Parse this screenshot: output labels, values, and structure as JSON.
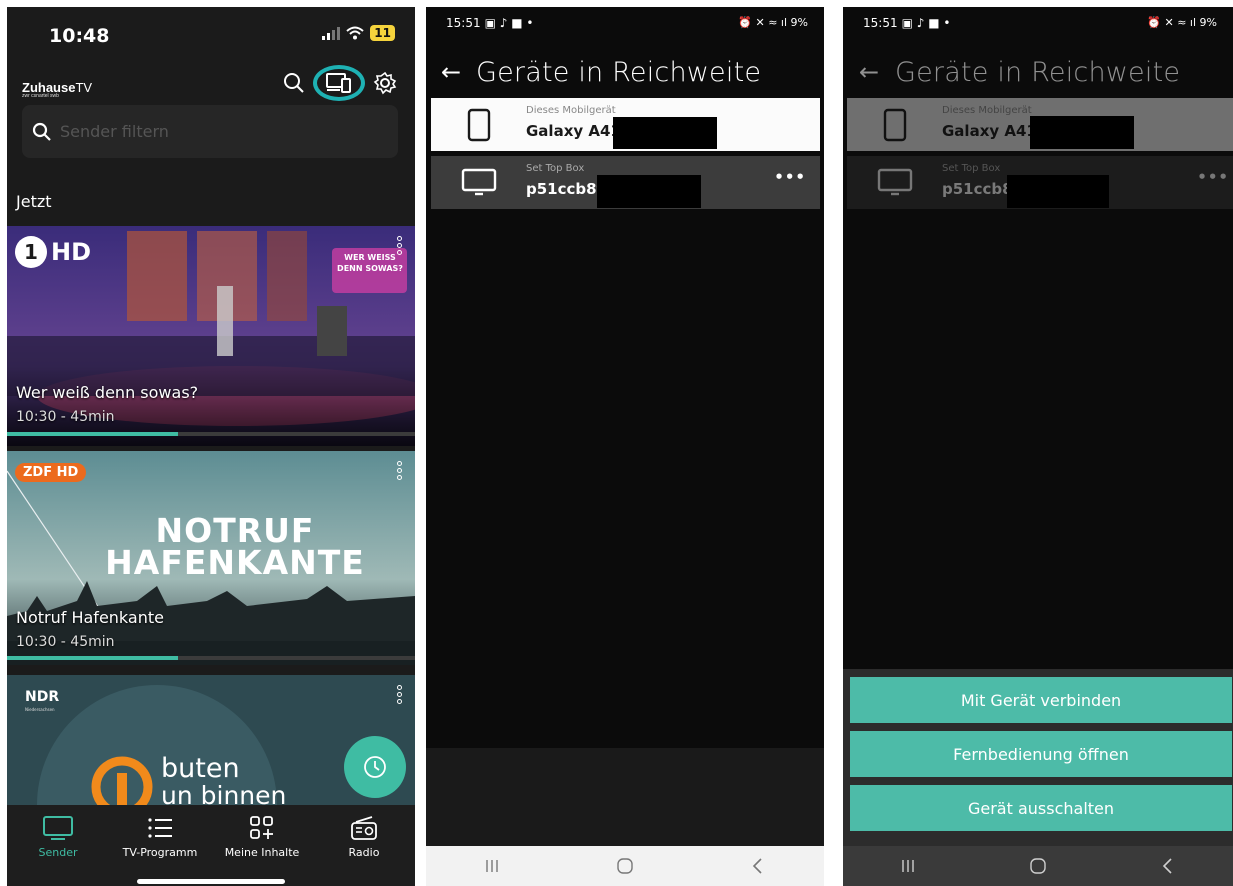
{
  "zuhause": {
    "status": {
      "time": "10:48",
      "battery": "11"
    },
    "logo": {
      "brand_bold": "Zuhause",
      "brand_light": "TV",
      "tagline": "zwr csnartel swb"
    },
    "search": {
      "placeholder": "Sender filtern"
    },
    "section_now": "Jetzt",
    "channels": [
      {
        "logo": "1HD",
        "title": "Wer weiß denn sowas?",
        "time": "10:30 - 45min",
        "progress": 0.42,
        "show_badge": "WER WEISS DENN SOWAS?"
      },
      {
        "logo": "ZDF HD",
        "title": "Notruf Hafenkante",
        "time": "10:30 - 45min",
        "progress": 0.42,
        "show_text": "NOTRUF HAFENKANTE"
      },
      {
        "logo": "NDR",
        "logo_sub": "Niedersachsen",
        "show_text_1": "buten",
        "show_text_2": "un binnen"
      }
    ],
    "nav": [
      {
        "label": "Sender",
        "icon": "tv-icon"
      },
      {
        "label": "TV-Programm",
        "icon": "list-icon"
      },
      {
        "label": "Meine Inhalte",
        "icon": "grid-plus-icon"
      },
      {
        "label": "Radio",
        "icon": "radio-icon"
      }
    ]
  },
  "android": {
    "time": "15:51",
    "battery": "9%",
    "title": "Geräte in Reichweite",
    "devices": [
      {
        "type_label": "Dieses Mobilgerät",
        "name": "Galaxy A41",
        "icon": "phone-icon"
      },
      {
        "type_label": "Set Top Box",
        "name_p2": "p51ccb8f",
        "name_p3": "p51ccb8",
        "more": "•••",
        "icon": "monitor-icon"
      }
    ],
    "actions": [
      "Mit Gerät verbinden",
      "Fernbedienung öffnen",
      "Gerät ausschalten"
    ]
  },
  "colors": {
    "accent": "#3fbca3",
    "highlight_ring": "#1eb1b3",
    "button": "#4dbba8"
  }
}
